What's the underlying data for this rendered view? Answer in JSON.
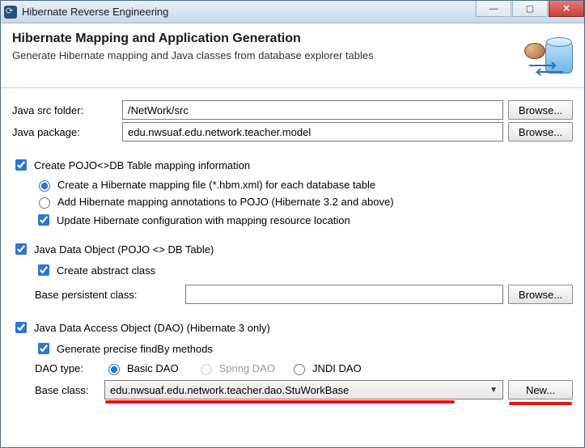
{
  "window": {
    "title": "Hibernate Reverse Engineering"
  },
  "header": {
    "title": "Hibernate Mapping and Application Generation",
    "subtitle": "Generate Hibernate mapping and Java classes from database explorer tables"
  },
  "form": {
    "src_label": "Java src folder:",
    "src_value": "/NetWork/src",
    "pkg_label": "Java package:",
    "pkg_value": "edu.nwsuaf.edu.network.teacher.model",
    "browse": "Browse..."
  },
  "pojo": {
    "create_label": "Create POJO<>DB Table mapping information",
    "hbm_label": "Create a Hibernate mapping file (*.hbm.xml) for each database table",
    "anno_label": "Add Hibernate mapping annotations to POJO (Hibernate 3.2 and above)",
    "update_cfg_label": "Update Hibernate configuration with mapping resource location"
  },
  "jdo": {
    "label": "Java Data Object (POJO <> DB Table)",
    "abstract_label": "Create abstract class",
    "bpc_label": "Base persistent class:",
    "bpc_value": ""
  },
  "dao": {
    "label": "Java Data Access Object (DAO) (Hibernate 3 only)",
    "findby_label": "Generate precise findBy methods",
    "type_label": "DAO type:",
    "basic": "Basic DAO",
    "spring": "Spring DAO",
    "jndi": "JNDI DAO",
    "base_label": "Base class:",
    "base_value": "edu.nwsuaf.edu.network.teacher.dao.StuWorkBase",
    "new_btn": "New..."
  }
}
